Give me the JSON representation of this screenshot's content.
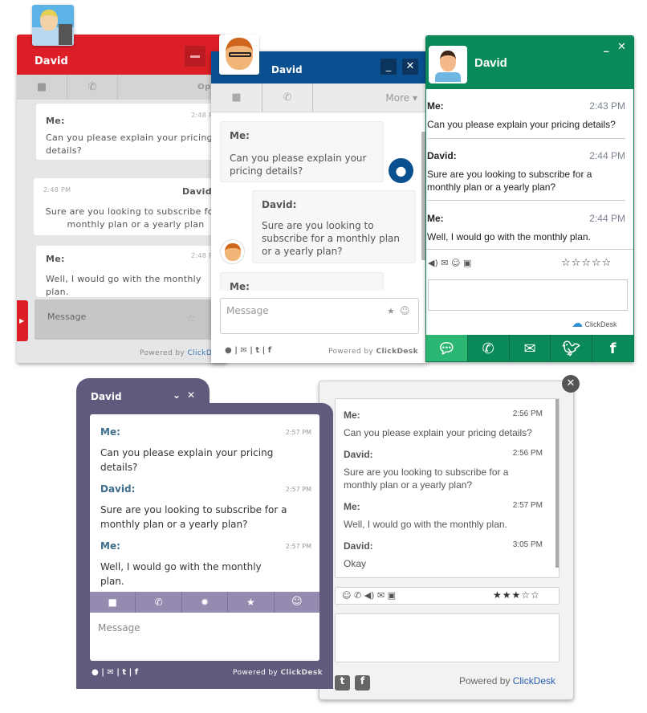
{
  "red_widget": {
    "title": "David",
    "accent": "#dc1f26",
    "toolbar": {
      "video_icon": "video-camera-icon",
      "phone_icon": "phone-icon",
      "options_label": "Option"
    },
    "messages": [
      {
        "sender": "Me:",
        "time": "2:48 PM",
        "text": "Can you please explain your pricing details?"
      },
      {
        "sender": "David",
        "time": "2:48 PM",
        "text": "Sure are you looking to subscribe for a monthly plan or a yearly plan"
      },
      {
        "sender": "Me:",
        "time": "2:48 PM",
        "text": "Well, I would go with the monthly plan."
      }
    ],
    "input_placeholder": "Message",
    "powered_by": "Powered by",
    "brand": "ClickD"
  },
  "blue_widget": {
    "title": "David",
    "accent": "#0a5090",
    "toolbar": {
      "more_label": "More ▾"
    },
    "messages": [
      {
        "sender": "Me:",
        "text": "Can you please explain your pricing details?"
      },
      {
        "sender": "David:",
        "text": "Sure are you looking to subscribe for a monthly plan or a yearly plan?"
      },
      {
        "sender": "Me:",
        "text": ""
      }
    ],
    "input_placeholder": "Message",
    "powered_by": "Powered by",
    "brand": "ClickDesk"
  },
  "green_widget": {
    "title": "David",
    "accent": "#0b8a59",
    "messages": [
      {
        "sender": "Me:",
        "time": "2:43 PM",
        "text": "Can you please explain your pricing details?"
      },
      {
        "sender": "David:",
        "time": "2:44 PM",
        "text": "Sure are you looking to subscribe for a monthly plan or a yearly plan?"
      },
      {
        "sender": "Me:",
        "time": "2:44 PM",
        "text": "Well, I would go with the monthly plan."
      }
    ],
    "rating": {
      "value": 0,
      "max": 5
    },
    "logo_text": "ClickDesk",
    "bottom_bar": [
      "chat-icon",
      "phone-icon",
      "email-icon",
      "twitter-icon",
      "facebook-icon"
    ]
  },
  "purple_widget": {
    "title": "David",
    "accent": "#625a7d",
    "messages": [
      {
        "sender": "Me:",
        "time": "2:57 PM",
        "text": "Can you please explain your pricing details?"
      },
      {
        "sender": "David:",
        "time": "2:57 PM",
        "text": "Sure are you looking to subscribe for a monthly plan or a yearly plan?"
      },
      {
        "sender": "Me:",
        "time": "2:57 PM",
        "text": "Well, I would go with the monthly plan."
      }
    ],
    "toolbar": [
      "video-camera-icon",
      "phone-icon",
      "gear-icon",
      "star-icon",
      "smiley-icon"
    ],
    "input_placeholder": "Message",
    "powered_by": "Powered by",
    "brand": "ClickDesk"
  },
  "gray_widget": {
    "messages": [
      {
        "sender": "Me:",
        "time": "2:56 PM",
        "text": "Can you please explain your pricing details?"
      },
      {
        "sender": "David:",
        "time": "2:56 PM",
        "text": "Sure are you looking to subscribe for a monthly plan or a yearly plan?"
      },
      {
        "sender": "Me:",
        "time": "2:57 PM",
        "text": "Well, I would go with the monthly plan."
      },
      {
        "sender": "David:",
        "time": "3:05 PM",
        "text": "Okay"
      }
    ],
    "rating": {
      "value": 3,
      "max": 5
    },
    "powered_by": "Powered by",
    "brand": "ClickDesk",
    "brand_color": "#2a5db0"
  }
}
